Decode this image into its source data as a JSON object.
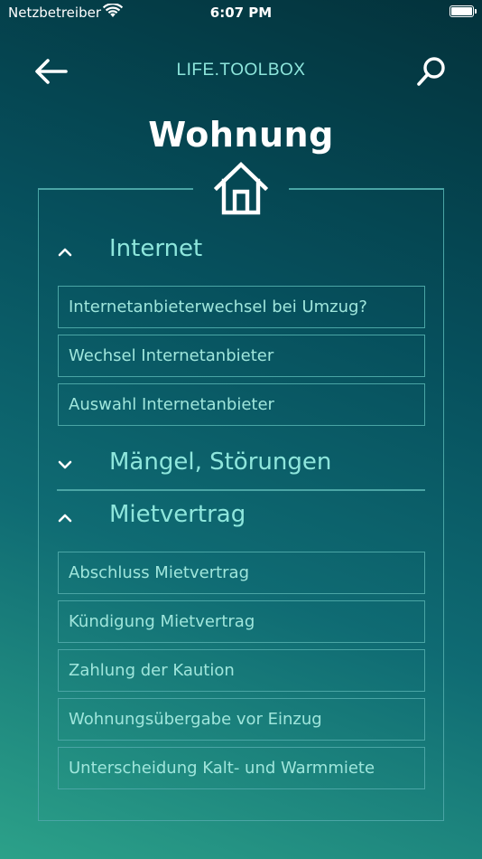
{
  "status_bar": {
    "carrier": "Netzbetreiber",
    "time": "6:07 PM"
  },
  "nav": {
    "title": "LIFE.TOOLBOX"
  },
  "page": {
    "title": "Wohnung"
  },
  "sections": [
    {
      "label": "Internet",
      "expanded": true,
      "items": [
        "Internetanbieterwechsel bei Umzug?",
        "Wechsel Internetanbieter",
        "Auswahl Internetanbieter"
      ]
    },
    {
      "label": "Mängel, Störungen",
      "expanded": false,
      "items": []
    },
    {
      "label": "Mietvertrag",
      "expanded": true,
      "items": [
        "Abschluss Mietvertrag",
        "Kündigung Mietvertrag",
        "Zahlung der Kaution",
        "Wohnungsübergabe vor Einzug",
        "Unterscheidung Kalt- und Warmmiete"
      ]
    }
  ],
  "colors": {
    "accent": "#8ee6dc",
    "border": "#4aa5a5",
    "bg_top": "#03323b",
    "bg_bottom": "#2ca189"
  }
}
